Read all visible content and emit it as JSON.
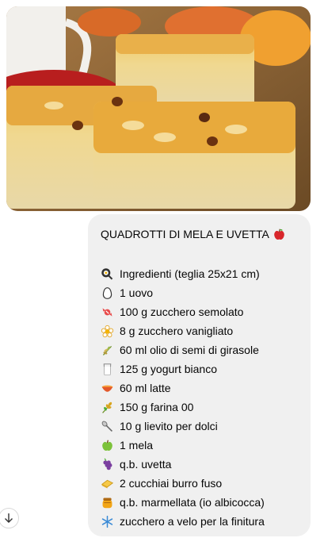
{
  "message": {
    "title": "QUADROTTI DI MELA E UVETTA",
    "title_icon": "red-apple-icon",
    "ingredients": [
      {
        "icon": "frying-pan-icon",
        "text": "Ingredienti (teglia 25x21 cm)"
      },
      {
        "icon": "egg-icon",
        "text": "1 uovo"
      },
      {
        "icon": "candy-icon",
        "text": "100 g zucchero semolato"
      },
      {
        "icon": "flower-icon",
        "text": "8 g zucchero vanigliato"
      },
      {
        "icon": "herb-icon",
        "text": "60 ml olio di semi di girasole"
      },
      {
        "icon": "glass-of-milk-icon",
        "text": "125 g yogurt bianco"
      },
      {
        "icon": "bowl-icon",
        "text": "60 ml latte"
      },
      {
        "icon": "ear-of-wheat-icon",
        "text": "150 g farina 00"
      },
      {
        "icon": "spoon-icon",
        "text": "10 g lievito per dolci"
      },
      {
        "icon": "green-apple-icon",
        "text": "1 mela"
      },
      {
        "icon": "grapes-icon",
        "text": "q.b. uvetta"
      },
      {
        "icon": "butter-icon",
        "text": "2 cucchiai burro fuso"
      },
      {
        "icon": "honey-pot-icon",
        "text": "q.b. marmellata (io albicocca)"
      },
      {
        "icon": "snowflake-icon",
        "text": "zucchero a velo per la finitura"
      }
    ]
  },
  "colors": {
    "bubble_bg": "#f0f0f0",
    "text": "#050505",
    "page_bg": "#ffffff"
  }
}
